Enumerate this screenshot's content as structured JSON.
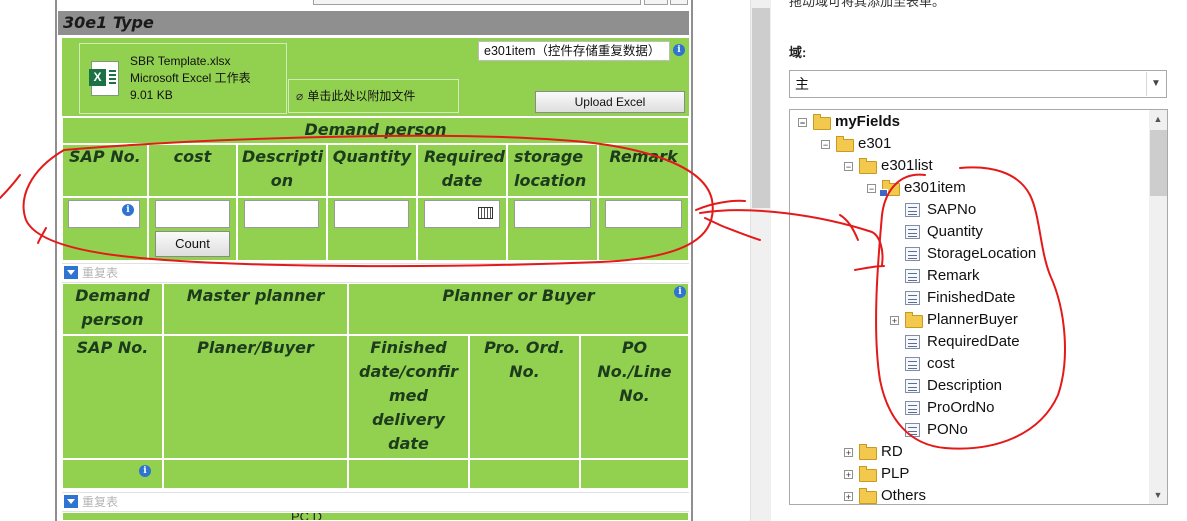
{
  "form": {
    "section_title": "30e1 Type",
    "attachment": {
      "file_name": "SBR Template.xlsx",
      "file_type": "Microsoft  Excel 工作表",
      "file_size": "9.01 KB",
      "icon": "excel-icon"
    },
    "repeating_data_label": "e301item（控件存储重复数据）",
    "attach_file_text": "单击此处以附加文件",
    "upload_button": "Upload Excel",
    "table1": {
      "group_header": "Demand person",
      "columns": [
        "SAP No.",
        "cost",
        "Descripti on",
        "Quantity",
        "Required date",
        "storage location",
        "Remark"
      ],
      "count_button": "Count"
    },
    "repeat_table_label": "重复表",
    "table2": {
      "group_headers": [
        "Demand person",
        "Master planner",
        "Planner or Buyer"
      ],
      "columns": [
        "SAP No.",
        "Planer/Buyer",
        "Finished date/confir med delivery date",
        "Pro. Ord. No.",
        "PO No./Line No."
      ]
    },
    "bottom_text": "PC D"
  },
  "panel": {
    "hint": "拖动域可将其添加至表单。",
    "domain_label": "域:",
    "domain_select_value": "主",
    "tree": [
      {
        "label": "myFields",
        "level": 0,
        "kind": "folder",
        "expanded": true,
        "bold": true
      },
      {
        "label": "e301",
        "level": 1,
        "kind": "folder",
        "expanded": true
      },
      {
        "label": "e301list",
        "level": 2,
        "kind": "folder",
        "expanded": true
      },
      {
        "label": "e301item",
        "level": 3,
        "kind": "repeating-folder",
        "expanded": true
      },
      {
        "label": "SAPNo",
        "level": 4,
        "kind": "field"
      },
      {
        "label": "Quantity",
        "level": 4,
        "kind": "field"
      },
      {
        "label": "StorageLocation",
        "level": 4,
        "kind": "field"
      },
      {
        "label": "Remark",
        "level": 4,
        "kind": "field"
      },
      {
        "label": "FinishedDate",
        "level": 4,
        "kind": "field"
      },
      {
        "label": "PlannerBuyer",
        "level": 4,
        "kind": "folder",
        "expanded": false
      },
      {
        "label": "RequiredDate",
        "level": 4,
        "kind": "field"
      },
      {
        "label": "cost",
        "level": 4,
        "kind": "field"
      },
      {
        "label": "Description",
        "level": 4,
        "kind": "field"
      },
      {
        "label": "ProOrdNo",
        "level": 4,
        "kind": "field"
      },
      {
        "label": "PONo",
        "level": 4,
        "kind": "field"
      },
      {
        "label": "RD",
        "level": 2,
        "kind": "folder",
        "expanded": false
      },
      {
        "label": "PLP",
        "level": 2,
        "kind": "folder",
        "expanded": false
      },
      {
        "label": "Others",
        "level": 2,
        "kind": "folder",
        "expanded": false
      }
    ]
  },
  "colors": {
    "form_green": "#92d050",
    "section_gray": "#8f8f8f",
    "annotation_red": "#e41a1a"
  }
}
